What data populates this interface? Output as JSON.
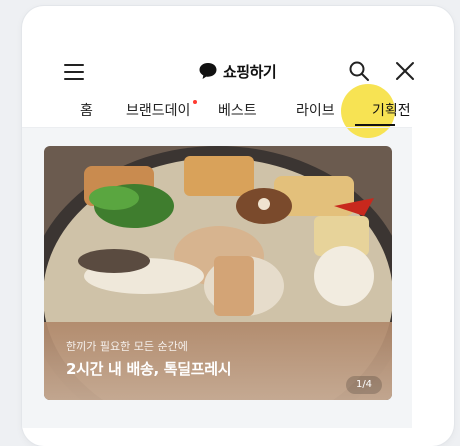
{
  "header": {
    "menu_icon": "hamburger-menu-icon",
    "brand_icon": "speech-bubble-icon",
    "title": "쇼핑하기",
    "search_icon": "search-icon",
    "close_icon": "close-icon"
  },
  "tabs": [
    {
      "label": "홈",
      "new_dot": false,
      "active": false
    },
    {
      "label": "브랜드데이",
      "new_dot": true,
      "active": false
    },
    {
      "label": "베스트",
      "new_dot": false,
      "active": false
    },
    {
      "label": "라이브",
      "new_dot": false,
      "active": false
    },
    {
      "label": "기획전",
      "new_dot": false,
      "active": true
    }
  ],
  "banner": {
    "subtitle": "한끼가 필요한 모든 순간에",
    "title": "2시간 내 배송, 톡딜프레시",
    "pager": "1/4",
    "image": "oden-hotpot-photo"
  },
  "colors": {
    "highlight": "#f7e14a",
    "new_dot": "#ff3b30",
    "overlay": "#b9967a"
  }
}
